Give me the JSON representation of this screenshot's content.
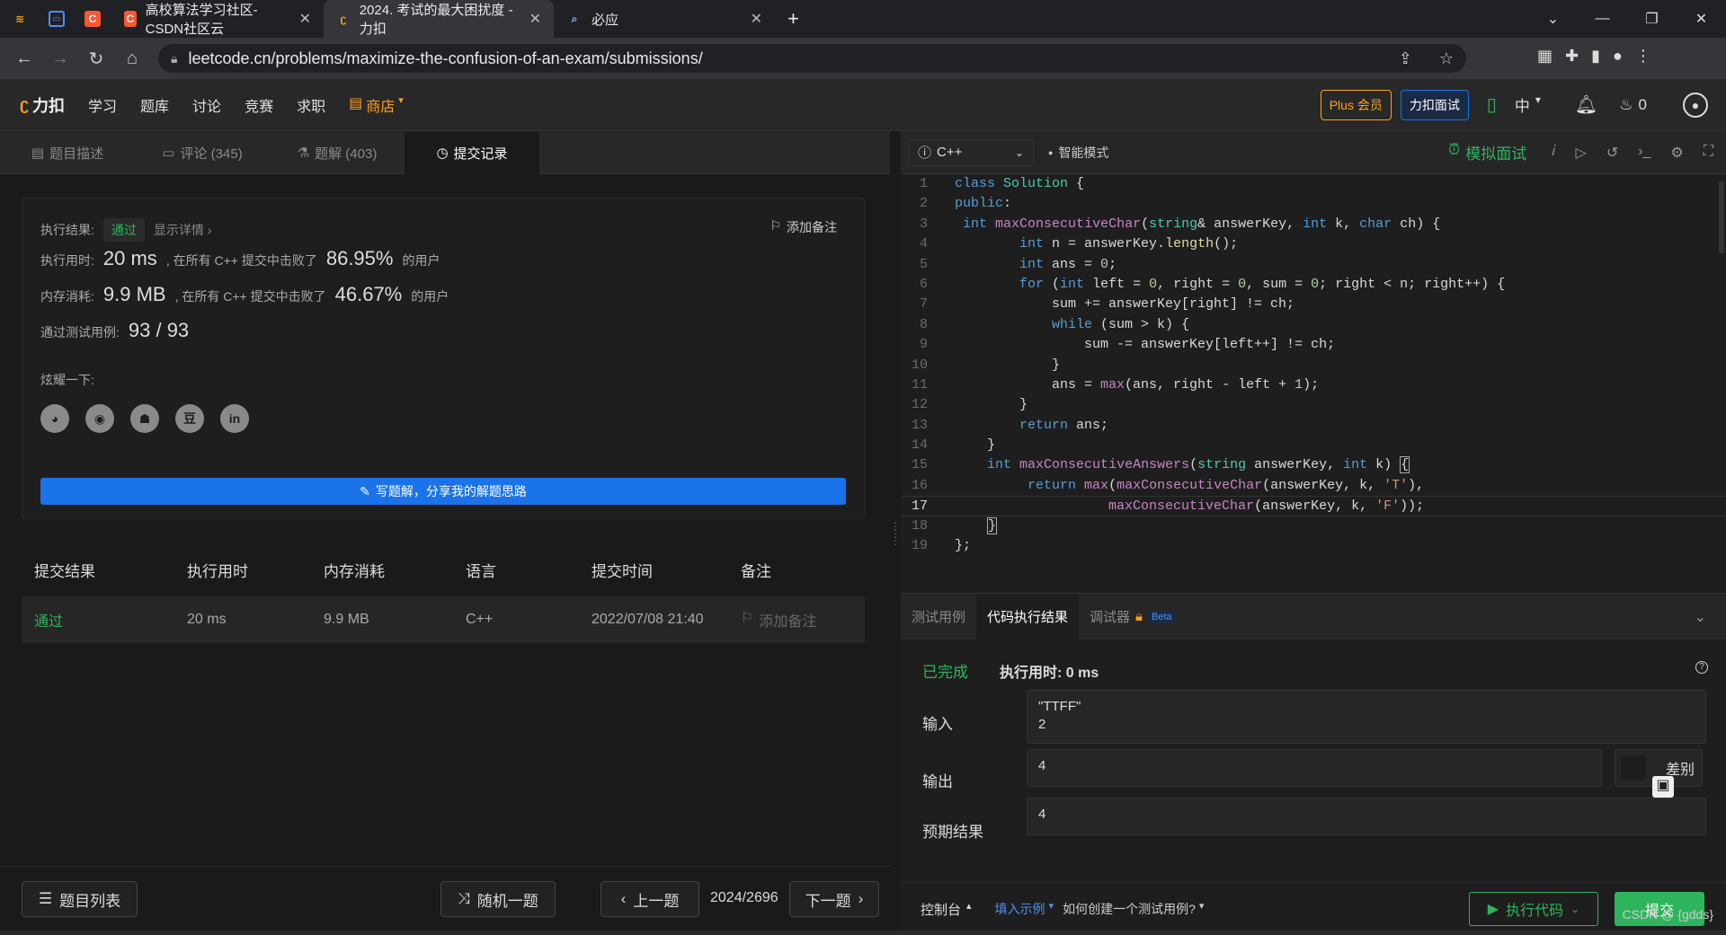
{
  "browser": {
    "tabs": [
      {
        "label": "",
        "icon": "flame-icon"
      },
      {
        "label": "",
        "icon": "calendar-icon"
      },
      {
        "label": "",
        "icon": "csdn-icon"
      },
      {
        "label": "高校算法学习社区-CSDN社区云",
        "icon": "csdn-icon"
      },
      {
        "label": "2024. 考试的最大困扰度 - 力扣",
        "icon": "leetcode-icon"
      },
      {
        "label": "必应",
        "icon": "search-icon"
      }
    ],
    "url": "leetcode.cn/problems/maximize-the-confusion-of-an-exam/submissions/"
  },
  "header": {
    "logo": "力扣",
    "nav": [
      "学习",
      "题库",
      "讨论",
      "竞赛",
      "求职"
    ],
    "store": "商店",
    "plus": "Plus 会员",
    "interview": "力扣面试",
    "lang": "中",
    "points": "0"
  },
  "left_tabs": [
    {
      "label": "题目描述"
    },
    {
      "label": "评论 (345)"
    },
    {
      "label": "题解 (403)"
    },
    {
      "label": "提交记录"
    }
  ],
  "result": {
    "status_label": "执行结果:",
    "status": "通过",
    "detail": "显示详情",
    "add_note": "添加备注",
    "time_label": "执行用时:",
    "time": "20 ms",
    "time_text": ", 在所有 C++ 提交中击败了",
    "time_pct": "86.95%",
    "users": "的用户",
    "mem_label": "内存消耗:",
    "mem": "9.9 MB",
    "mem_text": ", 在所有 C++ 提交中击败了",
    "mem_pct": "46.67%",
    "cases_label": "通过测试用例:",
    "cases": "93 / 93",
    "share_label": "炫耀一下:",
    "write": "写题解，分享我的解题思路"
  },
  "submissions": {
    "headers": [
      "提交结果",
      "执行用时",
      "内存消耗",
      "语言",
      "提交时间",
      "备注"
    ],
    "rows": [
      {
        "result": "通过",
        "time": "20 ms",
        "memory": "9.9 MB",
        "lang": "C++",
        "date": "2022/07/08 21:40",
        "note": "添加备注"
      }
    ]
  },
  "footer_left": {
    "list": "题目列表",
    "random": "随机一题",
    "prev": "上一题",
    "page": "2024/2696",
    "next": "下一题"
  },
  "editor": {
    "lang": "C++",
    "mode": "智能模式",
    "mock": "模拟面试",
    "current_line": 17
  },
  "console": {
    "tabs": [
      "测试用例",
      "代码执行结果",
      "调试器"
    ],
    "beta": "Beta",
    "done": "已完成",
    "exec_time": "执行用时: 0 ms",
    "input_label": "输入",
    "input": "\"TTFF\"\n2",
    "output_label": "输出",
    "output": "4",
    "diff": "差别",
    "expected_label": "预期结果",
    "expected": "4"
  },
  "footer_right": {
    "console": "控制台",
    "fill": "填入示例",
    "howto": "如何创建一个测试用例?",
    "run": "执行代码",
    "submit": "提交"
  },
  "watermark": "CSDN @ {gdds}",
  "colors": {
    "accent_green": "#2db55d",
    "accent_blue": "#1a73e8",
    "store_orange": "#ffa116"
  }
}
